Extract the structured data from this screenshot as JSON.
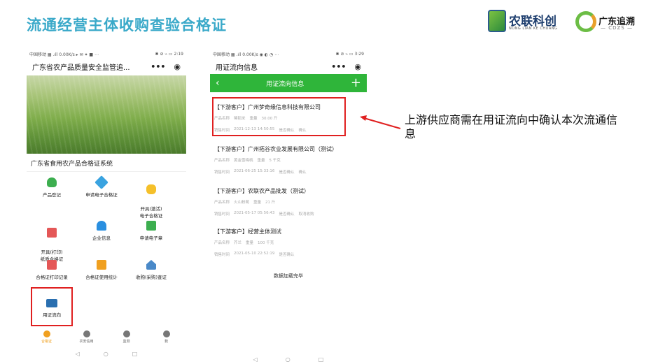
{
  "slide": {
    "title": "流通经营主体收购查验合格证",
    "title_color": "#3aa9c9",
    "logo1_text": "农联科创",
    "logo1_sub": "NONG LIAN KE CHUANG",
    "logo2_text": "广东追溯",
    "logo2_sub": "— CDZS —"
  },
  "phone1": {
    "status_left": "中国移动 ▦ .ıll 0.00K/s ▸ ✉ ✦ ■ ⋯",
    "status_right": "✱ ⊘ ⌁ ▭ 2:19",
    "app_title": "广东省农产品质量安全监管追...",
    "more_icon": "•••",
    "target_icon": "◉",
    "system_title": "广东省食用农产品合格证系统",
    "grid": [
      {
        "label": "产品登记",
        "icon": "broccoli-icon",
        "color": "#3cae4f"
      },
      {
        "label": "申请电子合格证",
        "icon": "rocket-icon",
        "color": "#3aa3e0"
      },
      {
        "label": "开具(激活)\n电子合格证",
        "icon": "hand-icon",
        "color": "#f5c02a"
      },
      {
        "label": "开具(打印)\n纸质合格证",
        "icon": "document-icon",
        "color": "#e45757"
      },
      {
        "label": "企业信息",
        "icon": "info-icon",
        "color": "#2a8fe0"
      },
      {
        "label": "申请电子章",
        "icon": "stamp-icon",
        "color": "#3cae4f"
      },
      {
        "label": "合格证打印记录",
        "icon": "box-icon",
        "color": "#e45757"
      },
      {
        "label": "合格证使用统计",
        "icon": "calculator-icon",
        "color": "#f0a020"
      },
      {
        "label": "收购(采购)查证",
        "icon": "home-icon",
        "color": "#4a89c8"
      },
      {
        "label": "用证流向",
        "icon": "sale-sign-icon",
        "color": "#2a6fb0"
      }
    ],
    "tabs": [
      {
        "label": "合格证",
        "active": true
      },
      {
        "label": "农安信用",
        "active": false
      },
      {
        "label": "监测",
        "active": false
      },
      {
        "label": "我",
        "active": false
      }
    ],
    "nav": [
      "◁",
      "○",
      "□"
    ]
  },
  "phone2": {
    "status_left": "中国移动 ▦ .ıll 0.00K/s ◉ ◐ ◔ ⋯",
    "status_right": "✱ ⊘ ⌁ ▭ 3:29",
    "app_title": "用证流向信息",
    "more_icon": "•••",
    "target_icon": "◉",
    "header_title": "用证流向信息",
    "records": [
      {
        "title": "【下游客户】广州梦奇缘信息科技有限公司",
        "product_label": "产品名称",
        "product": "稀稻米",
        "weight_label": "重量",
        "weight": "30.00 斤",
        "time_label": "销售时间",
        "time": "2021-12-13 14:50:55",
        "confirm_label": "是否确认",
        "confirm": "确认",
        "cancel": ""
      },
      {
        "title": "【下游客户】广州拓谷农业发展有限公司（测试）",
        "product_label": "产品名称",
        "product": "黄金雪梅桃",
        "weight_label": "重量",
        "weight": "5 千克",
        "time_label": "销售时间",
        "time": "2021-06-25 15:33:16",
        "confirm_label": "是否确认",
        "confirm": "确认",
        "cancel": ""
      },
      {
        "title": "【下游客户】农联农产品批发（测试）",
        "product_label": "产品名称",
        "product": "火山粉葛",
        "weight_label": "重量",
        "weight": "21 斤",
        "time_label": "销售时间",
        "time": "2021-05-17 05:56:43",
        "confirm_label": "是否确认",
        "confirm": "",
        "cancel": "取消收购"
      },
      {
        "title": "【下游客户】经营主体测试",
        "product_label": "产品名称",
        "product": "芥兰",
        "weight_label": "重量",
        "weight": "100 千克",
        "time_label": "销售时间",
        "time": "2021-05-10 22:52:19",
        "confirm_label": "是否确认",
        "confirm": "",
        "cancel": ""
      }
    ],
    "done_text": "数据加载完毕",
    "nav": [
      "◁",
      "○",
      "□"
    ]
  },
  "annotation": {
    "text": "上游供应商需在用证流向中确认本次流通信息",
    "arrow_color": "#e02020"
  }
}
